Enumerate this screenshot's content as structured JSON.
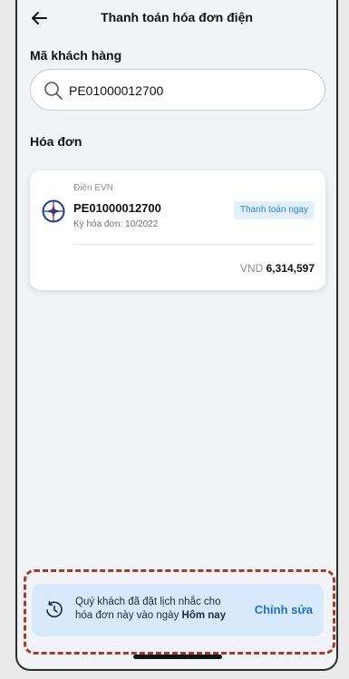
{
  "header": {
    "title": "Thanh toán hóa đơn điện"
  },
  "search": {
    "label": "Mã khách hàng",
    "value": "PE01000012700"
  },
  "bills_section": {
    "label": "Hóa đơn"
  },
  "bill": {
    "provider": "Điện EVN",
    "customer_code": "PE01000012700",
    "period": "Kỳ hóa đơn: 10/2022",
    "pay_label": "Thanh toán ngay",
    "currency": "VND",
    "amount": "6,314,597"
  },
  "reminder": {
    "text_line1": "Quý khách đã đặt lịch nhắc cho",
    "text_line2_prefix": "hóa đơn này vào ngày",
    "text_line2_bold": "Hôm nay",
    "edit_label": "Chỉnh sửa"
  },
  "colors": {
    "accent": "#1d6fd1",
    "badge_bg": "#e2f0fd",
    "reminder_bg": "#d7e9fb",
    "highlight": "#a33c2c"
  },
  "icons": {
    "back": "arrow-left-icon",
    "search": "search-icon",
    "provider": "evn-logo-icon",
    "reminder": "clock-reminder-icon"
  }
}
